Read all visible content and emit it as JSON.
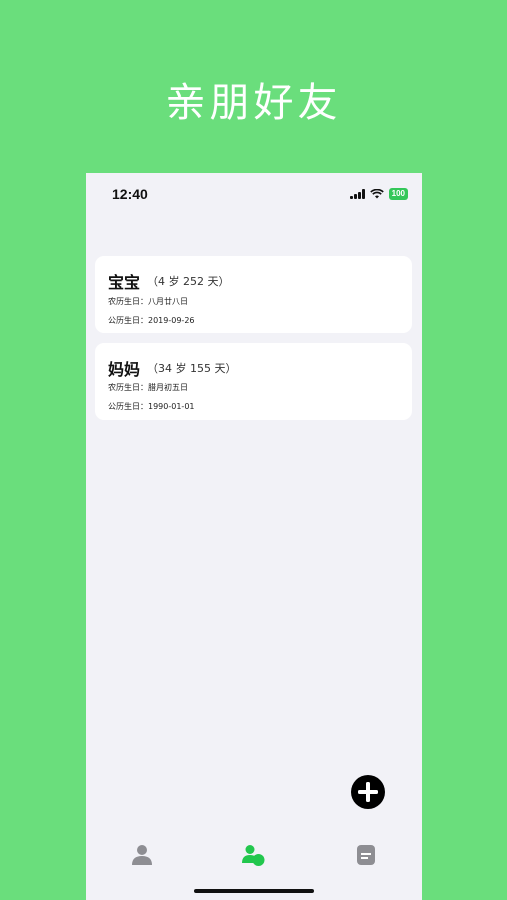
{
  "banner": {
    "title": "亲朋好友"
  },
  "status_bar": {
    "time": "12:40",
    "battery": "100"
  },
  "contacts": [
    {
      "name": "宝宝",
      "age": "（4 岁 252 天）",
      "lunar_label": "农历生日：",
      "lunar_value": "八月廿八日",
      "solar_label": "公历生日：",
      "solar_value": "2019-09-26"
    },
    {
      "name": "妈妈",
      "age": "（34 岁 155 天）",
      "lunar_label": "农历生日：",
      "lunar_value": "腊月初五日",
      "solar_label": "公历生日：",
      "solar_value": "1990-01-01"
    }
  ],
  "fab": {
    "icon": "plus-icon"
  },
  "tab_bar": {
    "items": [
      {
        "icon": "person-icon",
        "active": false
      },
      {
        "icon": "people-icon",
        "active": true
      },
      {
        "icon": "note-icon",
        "active": false
      }
    ]
  },
  "colors": {
    "background": "#6ade7c",
    "accent": "#34c759",
    "card": "#ffffff",
    "phone_bg": "#f2f2f7",
    "inactive_icon": "#8e8e93"
  }
}
